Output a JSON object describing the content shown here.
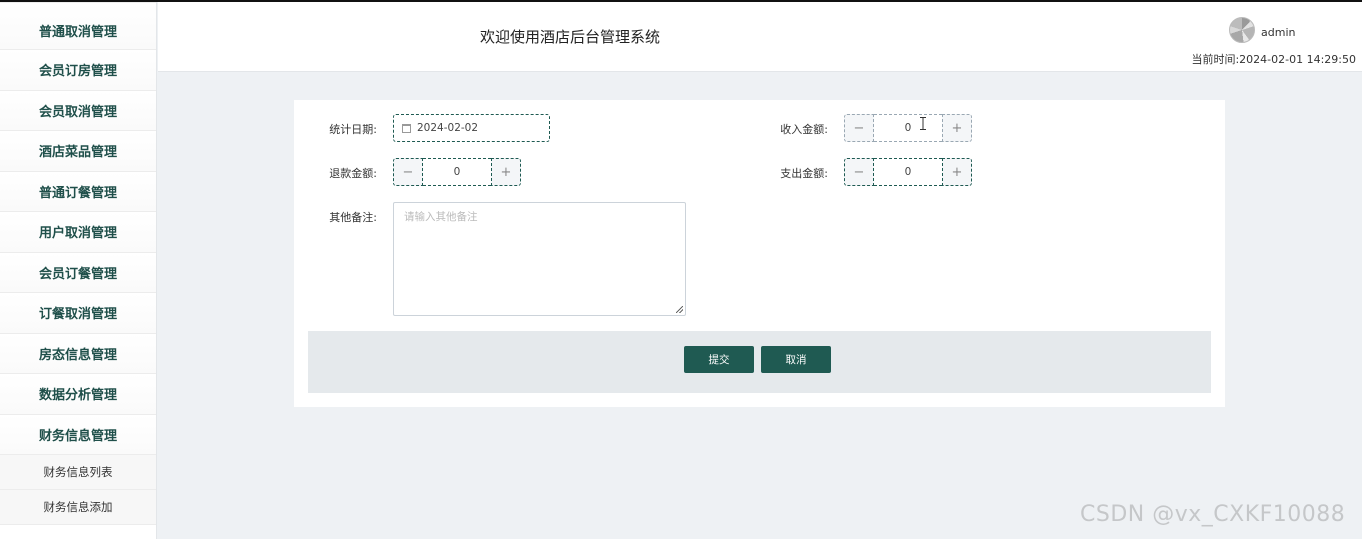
{
  "sidebar": {
    "items": [
      {
        "label": "普通取消管理"
      },
      {
        "label": "会员订房管理"
      },
      {
        "label": "会员取消管理"
      },
      {
        "label": "酒店菜品管理"
      },
      {
        "label": "普通订餐管理"
      },
      {
        "label": "用户取消管理"
      },
      {
        "label": "会员订餐管理"
      },
      {
        "label": "订餐取消管理"
      },
      {
        "label": "房态信息管理"
      },
      {
        "label": "数据分析管理"
      },
      {
        "label": "财务信息管理"
      }
    ],
    "subitems": [
      {
        "label": "财务信息列表"
      },
      {
        "label": "财务信息添加"
      }
    ]
  },
  "header": {
    "title": "欢迎使用酒店后台管理系统",
    "username": "admin",
    "time_label": "当前时间:",
    "time_value": "2024-02-01 14:29:50"
  },
  "form": {
    "stat_date_label": "统计日期:",
    "stat_date_value": "2024-02-02",
    "income_label": "收入金额:",
    "income_value": "0",
    "refund_label": "退款金额:",
    "refund_value": "0",
    "expense_label": "支出金额:",
    "expense_value": "0",
    "notes_label": "其他备注:",
    "notes_placeholder": "请输入其他备注",
    "minus": "−",
    "plus": "+"
  },
  "actions": {
    "submit_label": "提交",
    "cancel_label": "取消"
  },
  "watermark": "CSDN @vx_CXKF10088",
  "colors": {
    "accent": "#1f5a52",
    "sidebar_text": "#1f4f4a",
    "background": "#eef1f4"
  }
}
